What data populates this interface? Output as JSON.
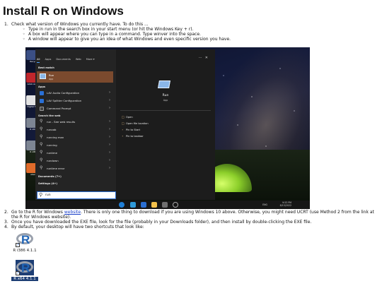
{
  "page": {
    "title": "Install R on Windows"
  },
  "steps": [
    {
      "num": "1.",
      "text": "Check what version of Windows you currently have. To do this ..."
    },
    {
      "num": "2.",
      "text_before": "Go to the R for Windows ",
      "link": "website",
      "text_after": ". There is only one thing to download if you are using Windows 10 above. Otherwise, you might need UCRT (use Method 2 from the link at the R for Windows website)."
    },
    {
      "num": "3.",
      "text": "Once you have downloaded the EXE file, look for the file (probably in your Downloads folder), and then install by double-clicking the EXE file."
    },
    {
      "num": "4.",
      "text": "By default, your desktop will have two shortcuts that look like:"
    }
  ],
  "substeps": [
    "Type in run in the search box in your start menu (or hit the Windows Key + r).",
    "A box will appear where you can type in a command. Type winver into the space.",
    "A window will appear to give you an idea of what Windows and even specific version you have."
  ],
  "desktop_icons": [
    "Recycle",
    "Adob Acroba",
    "Digital F App",
    "R x64 4",
    "R x86 4",
    "uberte"
  ],
  "start_menu": {
    "tabs": [
      "All",
      "Apps",
      "Documents",
      "Web",
      "More ▾"
    ],
    "best_match_label": "Best match",
    "best_match": {
      "name": "Run",
      "sub": "App"
    },
    "apps_label": "Apps",
    "apps": [
      {
        "label": "LAV Audio Configuration",
        "icon_color": "#2a70d6"
      },
      {
        "label": "LAV Splitter Configuration",
        "icon_color": "#2a70d6"
      },
      {
        "label": "Command Prompt",
        "icon_color": "#444444"
      }
    ],
    "web_label": "Search the web",
    "web": [
      "run - See web results",
      "runoob",
      "running man",
      "running",
      "runtime",
      "rundown",
      "runtime error"
    ],
    "documents_label": "Documents (7+)",
    "settings_label": "Settings (4+)",
    "preview": {
      "name": "Run",
      "type": "App"
    },
    "actions": [
      "Open",
      "Open file location",
      "Pin to Start",
      "Pin to taskbar"
    ],
    "search_value": "run"
  },
  "taskbar": {
    "time": "9:53 PM",
    "date": "8/15/2022",
    "lang": "ENG"
  },
  "shortcuts": [
    "R i386 4.1.1",
    "R x64 4.1.1"
  ]
}
